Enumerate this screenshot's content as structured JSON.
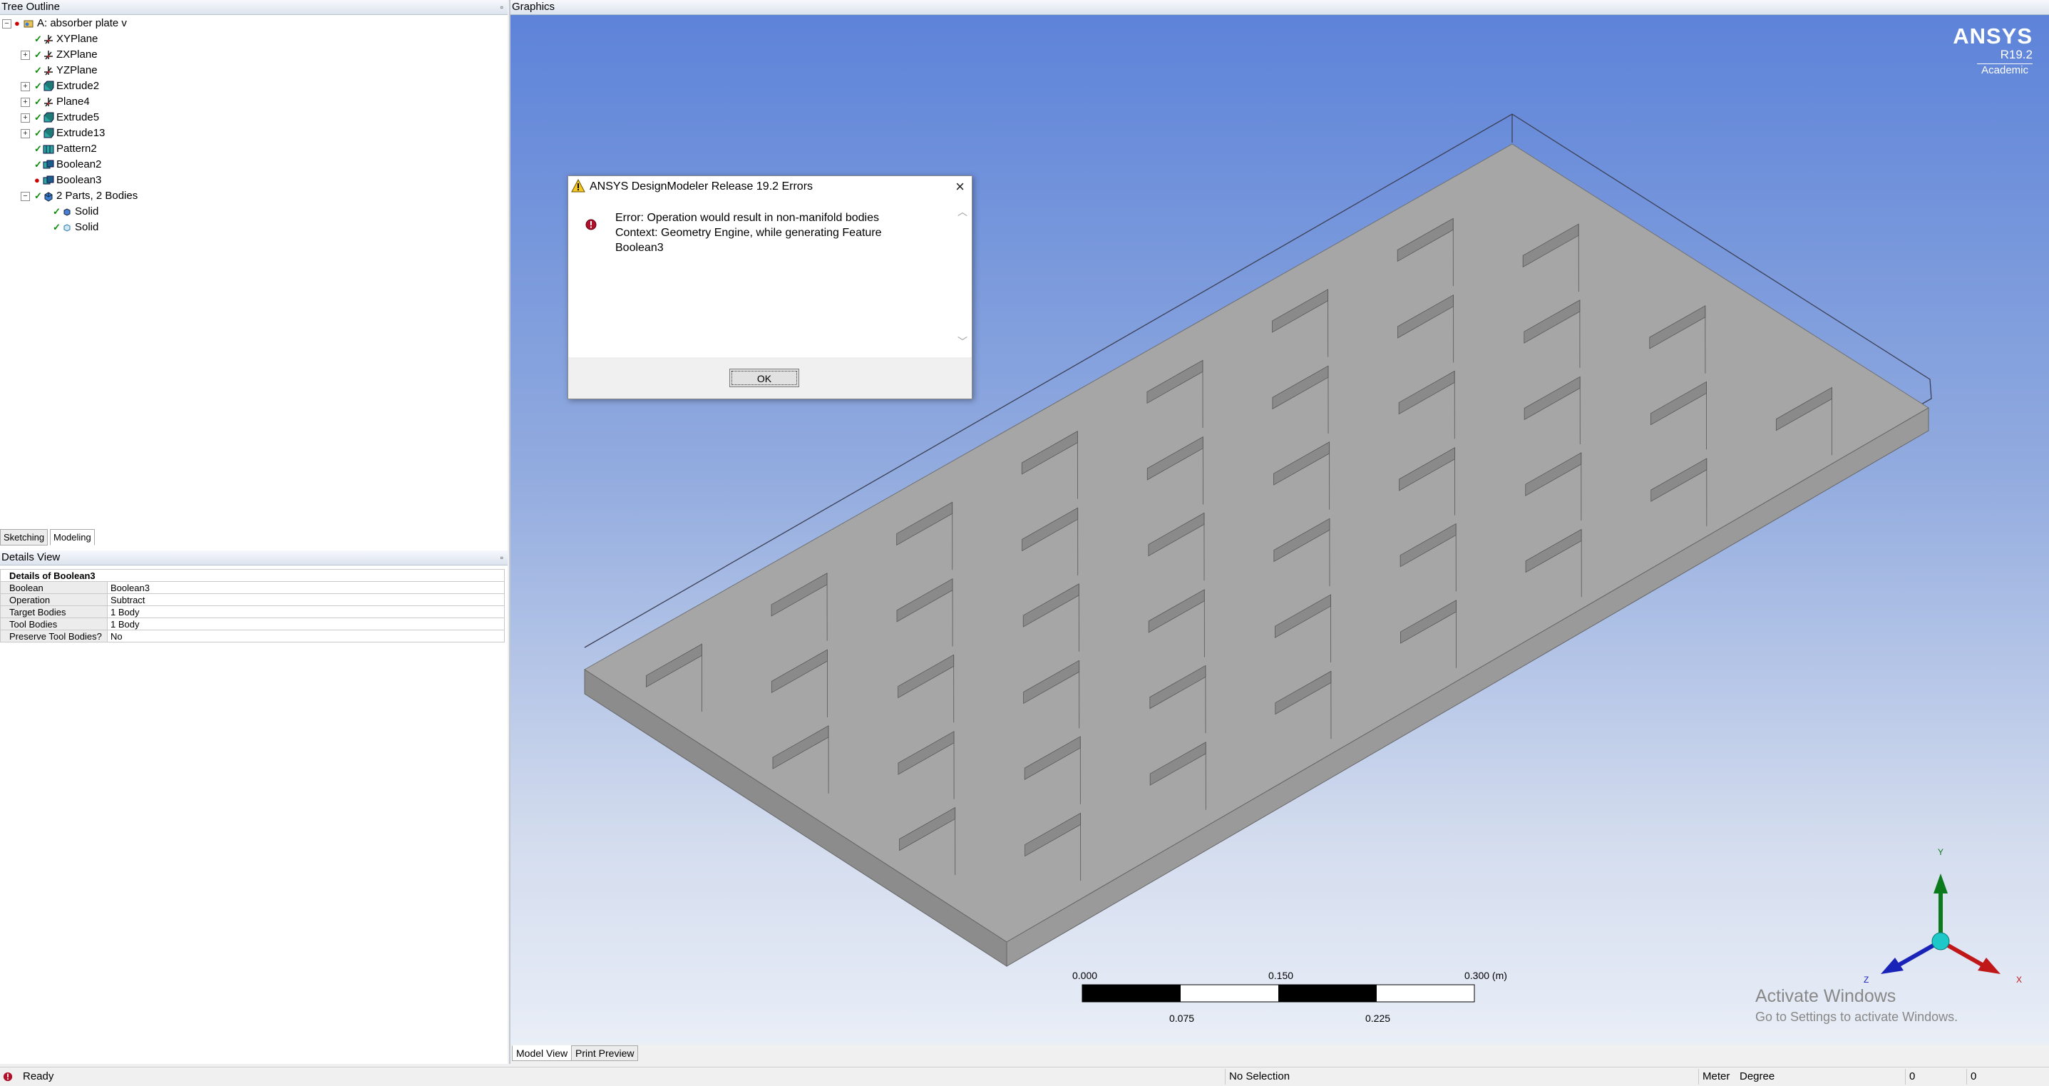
{
  "tree_outline": {
    "title": "Tree Outline",
    "items": [
      {
        "label": "A: absorber plate v",
        "icon": "model-icon"
      },
      {
        "label": "XYPlane",
        "icon": "plane-icon"
      },
      {
        "label": "ZXPlane",
        "icon": "plane-icon"
      },
      {
        "label": "YZPlane",
        "icon": "plane-icon"
      },
      {
        "label": "Extrude2",
        "icon": "extrude-icon"
      },
      {
        "label": "Plane4",
        "icon": "plane-icon"
      },
      {
        "label": "Extrude5",
        "icon": "extrude-icon"
      },
      {
        "label": "Extrude13",
        "icon": "extrude-icon"
      },
      {
        "label": "Pattern2",
        "icon": "pattern-icon"
      },
      {
        "label": "Boolean2",
        "icon": "boolean-icon"
      },
      {
        "label": "Boolean3",
        "icon": "boolean-icon"
      },
      {
        "label": "2 Parts, 2 Bodies",
        "icon": "parts-icon"
      },
      {
        "label": "Solid",
        "icon": "solid-icon"
      },
      {
        "label": "Solid",
        "icon": "solid-icon"
      }
    ]
  },
  "mode_tabs": [
    "Sketching",
    "Modeling"
  ],
  "details": {
    "title": "Details View",
    "header": "Details of Boolean3",
    "rows": [
      {
        "label": "Boolean",
        "value": "Boolean3"
      },
      {
        "label": "Operation",
        "value": "Subtract"
      },
      {
        "label": "Target Bodies",
        "value": "1 Body"
      },
      {
        "label": "Tool Bodies",
        "value": "1 Body"
      },
      {
        "label": "Preserve Tool Bodies?",
        "value": "No"
      }
    ]
  },
  "graphics": {
    "title": "Graphics",
    "logo": {
      "brand": "ANSYS",
      "version": "R19.2",
      "edition": "Academic"
    },
    "scale": {
      "top_labels": [
        "0.000",
        "0.150",
        "0.300 (m)"
      ],
      "bottom_labels": [
        "0.075",
        "0.225"
      ]
    },
    "triad": {
      "x": "X",
      "y": "Y",
      "z": "Z"
    },
    "view_tabs": [
      "Model View",
      "Print Preview"
    ],
    "watermark": {
      "line1": "Activate Windows",
      "line2": "Go to Settings to activate Windows."
    }
  },
  "dialog": {
    "title": "ANSYS DesignModeler Release 19.2 Errors",
    "lines": [
      "Error: Operation would result in non-manifold bodies",
      "Context: Geometry Engine, while generating Feature",
      "Boolean3"
    ],
    "ok_label": "OK"
  },
  "status_bar": {
    "status": "Ready",
    "selection": "No Selection",
    "units_length": "Meter",
    "units_angle": "Degree",
    "coord1": "0",
    "coord2": "0"
  }
}
